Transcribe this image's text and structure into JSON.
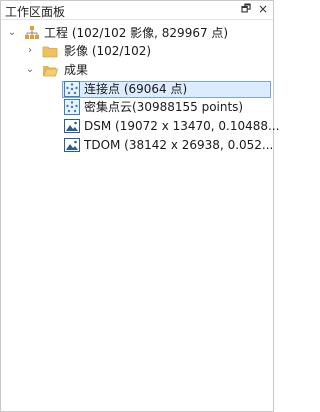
{
  "panel": {
    "title": "工作区面板",
    "pin_glyph": "🗗",
    "close_glyph": "×"
  },
  "tree": {
    "root": {
      "label": "工程 (102/102 影像, 829967 点)",
      "expander": "⌄",
      "icon": "project-icon"
    },
    "images": {
      "label": "影像 (102/102)",
      "expander": "›",
      "icon": "folder-icon"
    },
    "results": {
      "label": "成果",
      "expander": "⌄",
      "icon": "folder-icon"
    },
    "tie_points": {
      "label": "连接点 (69064 点)",
      "icon": "point-cloud-icon"
    },
    "dense_cloud": {
      "label": "密集点云(30988155 points)",
      "icon": "point-cloud-icon"
    },
    "dsm": {
      "label": "DSM (19072 x 13470, 0.10488...",
      "icon": "image-icon"
    },
    "tdom": {
      "label": "TDOM (38142 x 26938, 0.052...",
      "icon": "image-icon"
    }
  },
  "colors": {
    "folder": "#f0c060",
    "selection": "#dcecfc",
    "selection_border": "#7aa7da",
    "accent": "#3a7fc4"
  }
}
